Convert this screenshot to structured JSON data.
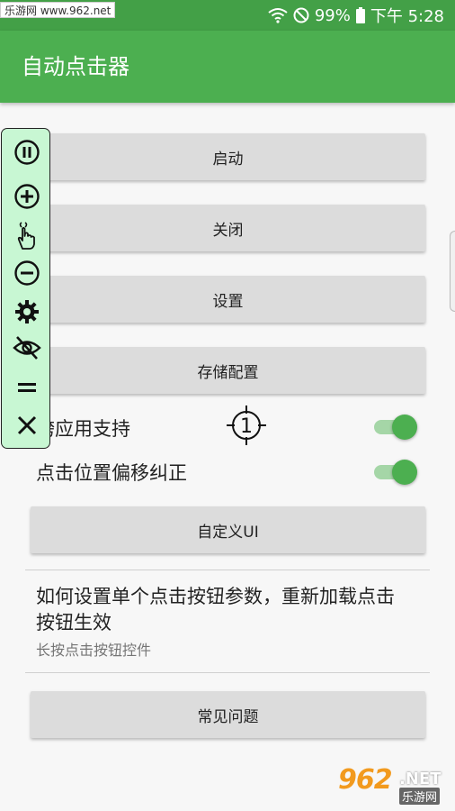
{
  "status_bar": {
    "watermark": "乐游网 www.962.net",
    "battery": "99%",
    "time": "下午 5:28"
  },
  "app_bar": {
    "title": "自动点击器"
  },
  "buttons": {
    "start": "启动",
    "close": "关闭",
    "settings": "设置",
    "save_config": "存储配置",
    "custom_ui": "自定义UI",
    "faq": "常见问题"
  },
  "switches": {
    "cross_app": {
      "label": "跨应用支持",
      "on": true
    },
    "offset_fix": {
      "label": "点击位置偏移纠正",
      "on": true
    }
  },
  "help": {
    "title": "如何设置单个点击按钮参数，重新加载点击按钮生效",
    "subtitle": "长按点击按钮控件"
  },
  "crosshair": {
    "number": "1"
  },
  "toolbar": {
    "icons": [
      "pause-icon",
      "plus-icon",
      "tap-hand-icon",
      "minus-icon",
      "gear-icon",
      "eye-off-icon",
      "equals-icon",
      "close-icon"
    ]
  },
  "watermark_bottom": {
    "num": "962",
    "net": ".NET",
    "cn": "乐游网"
  },
  "colors": {
    "primary": "#4caf50",
    "status": "#43a047",
    "toolbar_bg": "#c8f7d3",
    "button_bg": "#dcdcdc"
  }
}
